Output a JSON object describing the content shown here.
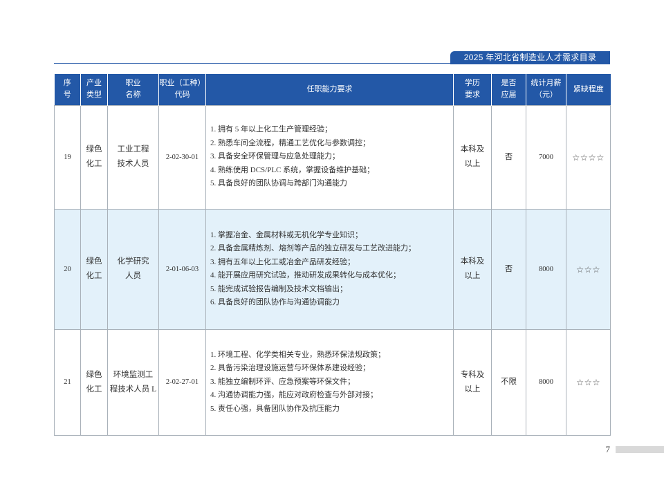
{
  "header_tag": {
    "title": "2025 年河北省制造业人才需求目录"
  },
  "table": {
    "columns": [
      "序\n号",
      "产业\n类型",
      "职业\n名称",
      "职业（工种）\n代码",
      "任职能力要求",
      "学历\n要求",
      "是否\n应届",
      "统计月薪\n（元）",
      "紧缺程度"
    ],
    "rows": [
      {
        "seq": "19",
        "industry": "绿色\n化工",
        "occupation": "工业工程\n技术人员",
        "code": "2-02-30-01",
        "requirements": [
          "1. 拥有 5 年以上化工生产管理经验；",
          "2. 熟悉车间全流程，精通工艺优化与参数调控；",
          "3. 具备安全环保管理与应急处理能力；",
          "4. 熟练使用 DCS/PLC 系统，掌握设备维护基础；",
          "5. 具备良好的团队协调与跨部门沟通能力"
        ],
        "education": "本科及\n以上",
        "fresh_grad": "否",
        "salary": "7000",
        "shortage": "☆☆☆☆"
      },
      {
        "seq": "20",
        "industry": "绿色\n化工",
        "occupation": "化学研究\n人员",
        "code": "2-01-06-03",
        "requirements": [
          "1. 掌握冶金、金属材料或无机化学专业知识；",
          "2. 具备金属精炼剂、熔剂等产品的独立研发与工艺改进能力；",
          "3. 拥有五年以上化工或冶金产品研发经验；",
          "4. 能开展应用研究试验，推动研发成果转化与成本优化；",
          "5. 能完成试验报告编制及技术文档输出；",
          "6. 具备良好的团队协作与沟通协调能力"
        ],
        "education": "本科及\n以上",
        "fresh_grad": "否",
        "salary": "8000",
        "shortage": "☆☆☆"
      },
      {
        "seq": "21",
        "industry": "绿色\n化工",
        "occupation": "环境监测工\n程技术人员 L",
        "code": "2-02-27-01",
        "requirements": [
          "1. 环境工程、化学类相关专业，熟悉环保法规政策；",
          "2. 具备污染治理设施运营与环保体系建设经验；",
          "3. 能独立编制环评、应急预案等环保文件；",
          "4. 沟通协调能力强，能应对政府检查与外部对接；",
          "5. 责任心强，具备团队协作及抗压能力"
        ],
        "education": "专科及\n以上",
        "fresh_grad": "不限",
        "salary": "8000",
        "shortage": "☆☆☆"
      }
    ]
  },
  "footer": {
    "page_number": "7"
  },
  "colors": {
    "header_blue": "#2358a7",
    "row_highlight": "#e3f1fa",
    "grid_line": "#a9b1b9",
    "page_bar": "#d9d9d9"
  }
}
